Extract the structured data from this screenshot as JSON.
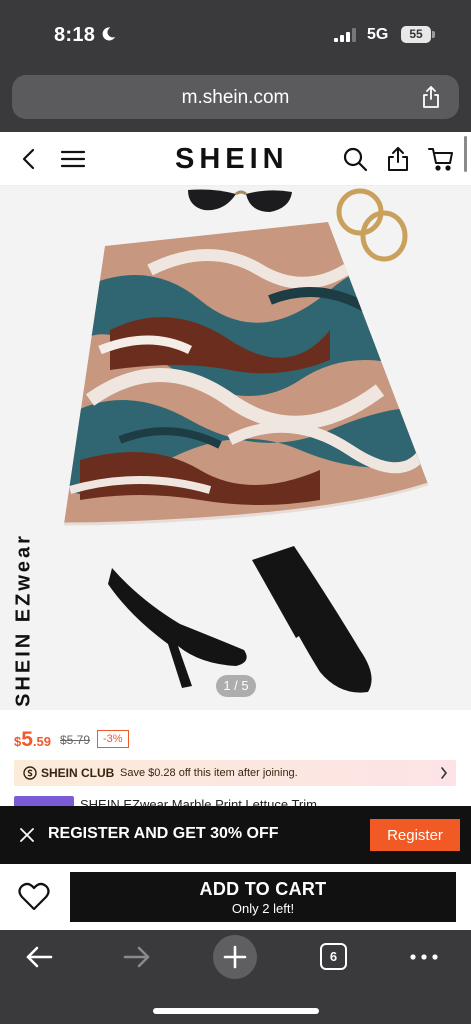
{
  "status_bar": {
    "time": "8:18",
    "network": "5G",
    "battery": "55"
  },
  "browser": {
    "url": "m.shein.com",
    "tabs_count": "6"
  },
  "site": {
    "logo": "SHEIN"
  },
  "product": {
    "brand_vertical": "SHEIN EZwear",
    "image_counter": "1 / 5",
    "price_symbol": "$",
    "price_whole": "5",
    "price_cents": ".59",
    "original_price": "$5.79",
    "discount": "-3%",
    "club": {
      "name": "SHEIN CLUB",
      "text": "Save $0.28 off this item after joining."
    },
    "title": "SHEIN EZwear Marble Print Lettuce Trim"
  },
  "register_banner": {
    "text": "REGISTER AND GET 30% OFF",
    "button": "Register"
  },
  "cart": {
    "add_label": "ADD TO CART",
    "stock_note": "Only 2 left!"
  },
  "colors": {
    "accent": "#f15a24",
    "dark": "#111111",
    "browser_chrome": "#3a3a3c",
    "club_purple": "#7c5cd6",
    "skirt_teal": "#2f6672",
    "skirt_brown": "#6b2d1e",
    "skirt_tan": "#c7977f"
  }
}
